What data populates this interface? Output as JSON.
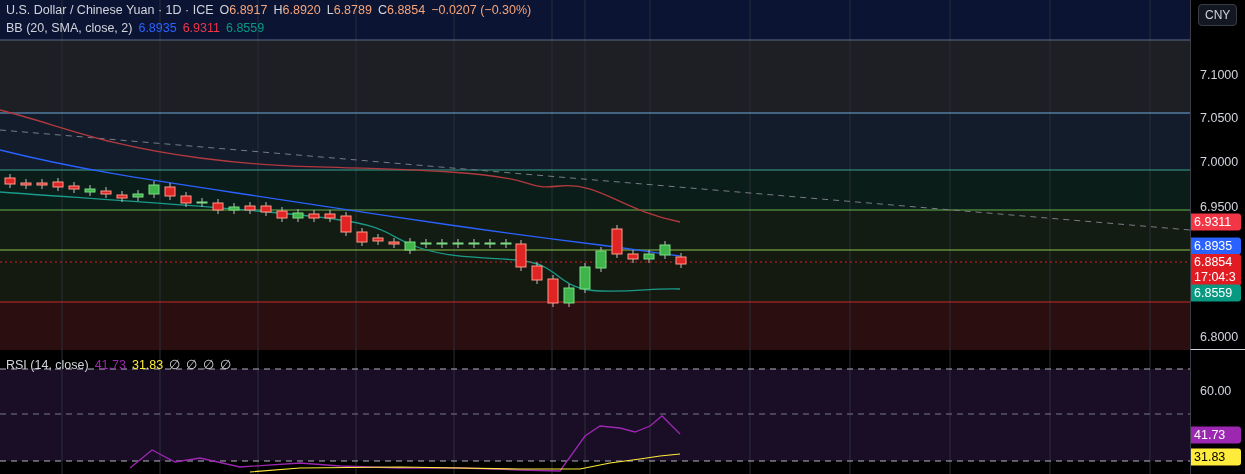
{
  "symbol_legend": {
    "title": "U.S. Dollar / Chinese Yuan · 1D · ICE",
    "ohlc": [
      {
        "label": "O",
        "value": "6.8917"
      },
      {
        "label": "H",
        "value": "6.8920"
      },
      {
        "label": "L",
        "value": "6.8789"
      },
      {
        "label": "C",
        "value": "6.8854"
      }
    ],
    "change": "−0.0207 (−0.30%)"
  },
  "indicator_legend": {
    "name": "BB (20, SMA, close, 2)",
    "values": [
      {
        "text": "6.8935",
        "color": "#2962ff"
      },
      {
        "text": "6.9311",
        "color": "#f23645"
      },
      {
        "text": "6.8559",
        "color": "#089981"
      }
    ]
  },
  "currency_button": "CNY",
  "price_axis": {
    "labels": [
      "7.1000",
      "7.0500",
      "7.0000",
      "6.9500",
      "6.8000"
    ],
    "tags": [
      {
        "text": "6.9311",
        "color": "#f23645"
      },
      {
        "text": "6.8935",
        "color": "#2962ff"
      },
      {
        "text": "6.8854",
        "subtext": "17:04:3",
        "color": "#e01b22"
      },
      {
        "text": "6.8559",
        "color": "#089981"
      }
    ]
  },
  "rsi": {
    "legend": "RSI (14, close)",
    "values": [
      {
        "text": "41.73",
        "color": "#9c27b0"
      },
      {
        "text": "31.83",
        "color": "#ffeb3b"
      }
    ],
    "extras": [
      "∅",
      "∅",
      "∅",
      "∅"
    ],
    "axis_labels": [
      "60.00"
    ],
    "tags": [
      {
        "text": "41.73",
        "color": "#9c27b0"
      },
      {
        "text": "31.83",
        "color": "#ffeb3b"
      }
    ]
  }
}
